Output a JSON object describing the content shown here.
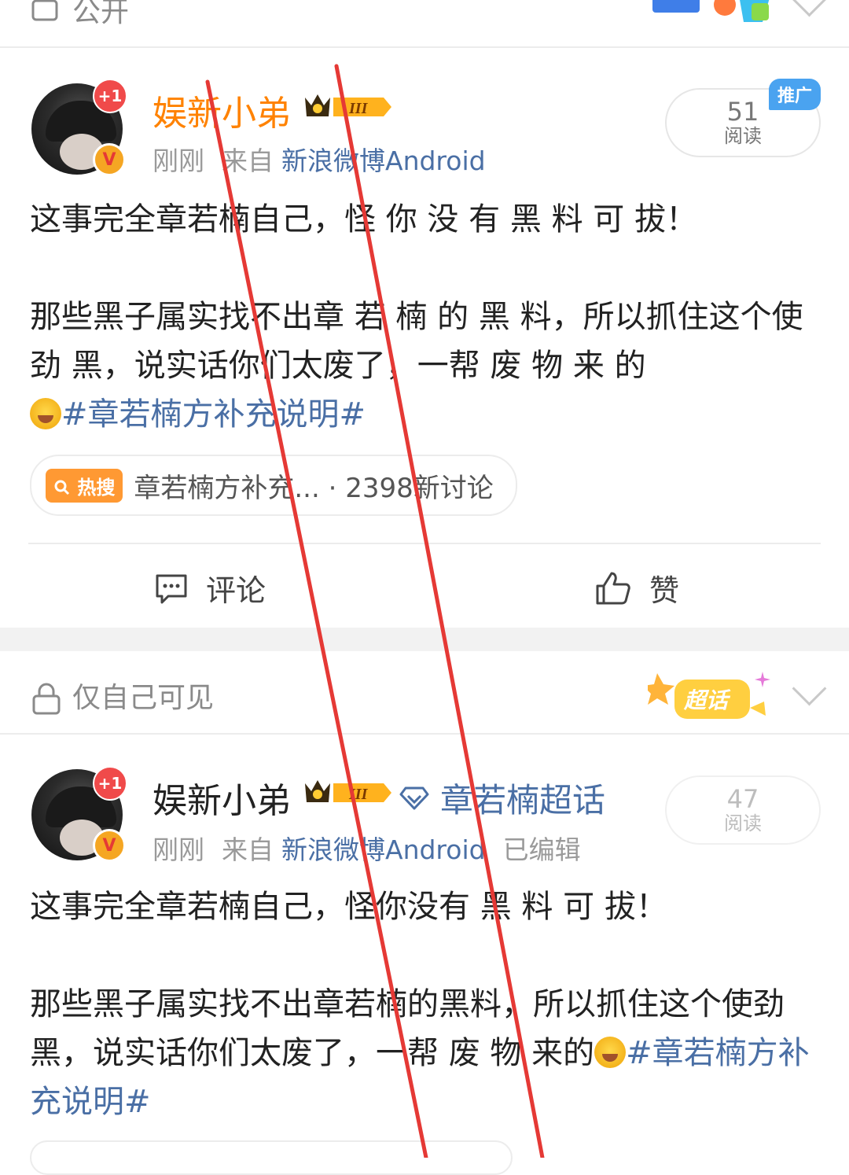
{
  "top": {
    "privacy": "公开"
  },
  "post1": {
    "username": "娱新小弟",
    "plus_badge": "+1",
    "vip_level": "III",
    "time": "刚刚",
    "from_label": "来自",
    "source": "新浪微博Android",
    "reads": "51",
    "reads_label": "阅读",
    "promo": "推广",
    "text_line1": "这事完全章若楠自己，怪 你 没 有 黑 料 可 拔！",
    "text_para2": "那些黑子属实找不出章 若 楠 的 黑 料，所以抓住这个使 劲 黑，说实话你们太废了，一帮 废 物 来 的",
    "topic": "#章若楠方补充说明#",
    "hot_tag": "热搜",
    "hot_text": "章若楠方补充... · 2398新讨论",
    "comment_label": "评论",
    "like_label": "赞"
  },
  "post2": {
    "privacy": "仅自己可见",
    "sticker_label": "超话",
    "username": "娱新小弟",
    "plus_badge": "+1",
    "vip_level": "III",
    "supertopic": "章若楠超话",
    "time": "刚刚",
    "from_label": "来自",
    "source": "新浪微博Android",
    "edited": "已编辑",
    "reads": "47",
    "reads_label": "阅读",
    "text_line1": "这事完全章若楠自己，怪你没有 黑 料 可 拔！",
    "text_para2": "那些黑子属实找不出章若楠的黑料，所以抓住这个使劲黑，说实话你们太废了，一帮 废 物 来的",
    "topic": "#章若楠方补充说明#"
  },
  "colors": {
    "accent_orange": "#ff8200",
    "link_blue": "#4a6fa5",
    "annotation_red": "#e53935"
  }
}
